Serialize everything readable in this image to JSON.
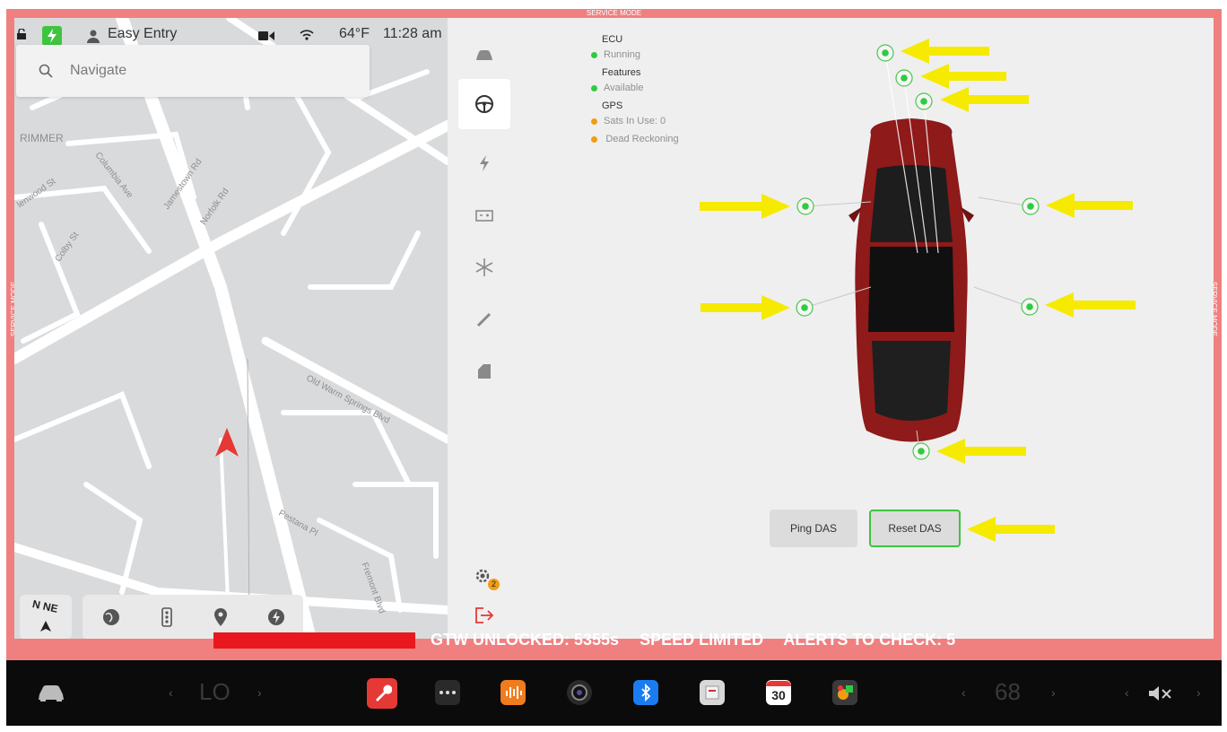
{
  "service_mode": {
    "label": "SERVICE MODE"
  },
  "status_bar": {
    "profile": "Easy Entry",
    "temperature": "64°F",
    "time": "11:28 am"
  },
  "search": {
    "placeholder": "Navigate"
  },
  "map": {
    "labels": [
      "RIMMER",
      "Columbia Ave",
      "Jamestown Rd",
      "Norfolk Rd",
      "lenwood St",
      "Colby St",
      "Old Warm Springs Blvd",
      "Pestana Pl",
      "Fremont Blvd"
    ],
    "compass": "N NE"
  },
  "diagnostics": {
    "ecu": {
      "title": "ECU",
      "status": "Running",
      "color": "#2ecc40"
    },
    "features": {
      "title": "Features",
      "status": "Available",
      "color": "#2ecc40"
    },
    "gps": {
      "title": "GPS",
      "sats": "Sats In Use: 0",
      "dead": "Dead Reckoning",
      "color": "#f39c12"
    }
  },
  "buttons": {
    "ping": "Ping DAS",
    "reset": "Reset DAS"
  },
  "alerts": {
    "gtw": "GTW UNLOCKED: 5355s",
    "speed": "SPEED LIMITED",
    "check": "ALERTS TO CHECK: 5"
  },
  "nav_badge": "2",
  "taskbar": {
    "left_temp": "LO",
    "right_temp": "68",
    "calendar_day": "30"
  },
  "colors": {
    "accent_green": "#3ec43e",
    "service_pink": "#f08080",
    "alert_red": "#e8181e",
    "arrow_yellow": "#f5ea00"
  }
}
